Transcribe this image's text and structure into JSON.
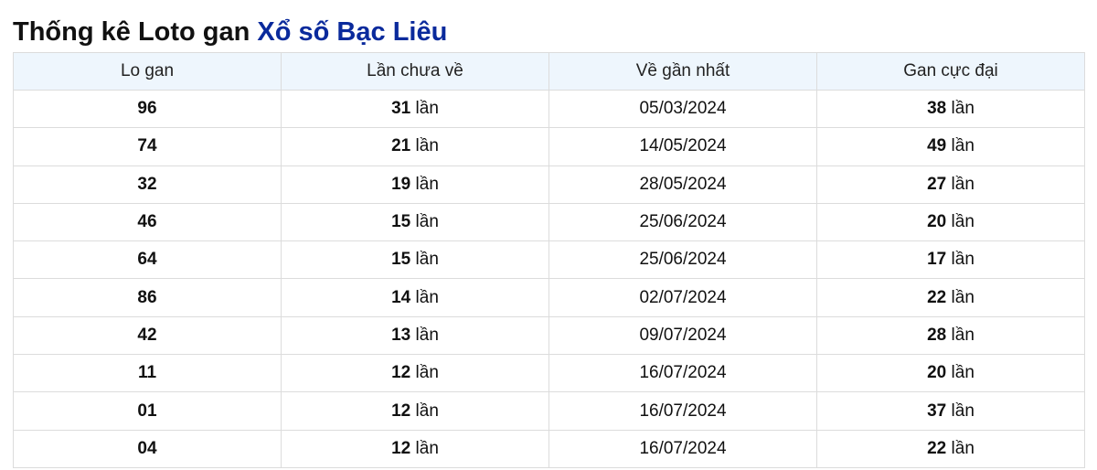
{
  "title": {
    "prefix": "Thống kê Loto gan",
    "highlight": "Xổ số Bạc Liêu"
  },
  "table": {
    "headers": [
      "Lo gan",
      "Lần chưa về",
      "Về gần nhất",
      "Gan cực đại"
    ],
    "unit": "lần",
    "rows": [
      {
        "number": "96",
        "missed": "31",
        "last_seen": "05/03/2024",
        "max_gap": "38"
      },
      {
        "number": "74",
        "missed": "21",
        "last_seen": "14/05/2024",
        "max_gap": "49"
      },
      {
        "number": "32",
        "missed": "19",
        "last_seen": "28/05/2024",
        "max_gap": "27"
      },
      {
        "number": "46",
        "missed": "15",
        "last_seen": "25/06/2024",
        "max_gap": "20"
      },
      {
        "number": "64",
        "missed": "15",
        "last_seen": "25/06/2024",
        "max_gap": "17"
      },
      {
        "number": "86",
        "missed": "14",
        "last_seen": "02/07/2024",
        "max_gap": "22"
      },
      {
        "number": "42",
        "missed": "13",
        "last_seen": "09/07/2024",
        "max_gap": "28"
      },
      {
        "number": "11",
        "missed": "12",
        "last_seen": "16/07/2024",
        "max_gap": "20"
      },
      {
        "number": "01",
        "missed": "12",
        "last_seen": "16/07/2024",
        "max_gap": "37"
      },
      {
        "number": "04",
        "missed": "12",
        "last_seen": "16/07/2024",
        "max_gap": "22"
      }
    ]
  },
  "colors": {
    "title_accent": "#0a2a9c",
    "date_text": "#13307f",
    "header_bg": "#eef6fd",
    "border": "#dcdcdc"
  }
}
